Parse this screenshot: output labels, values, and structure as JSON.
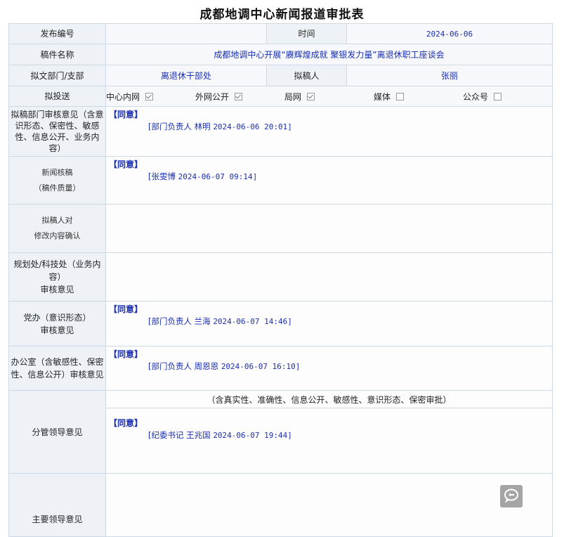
{
  "page_title": "成都地调中心新闻报道审批表",
  "rows": {
    "publish_no": {
      "label": "发布编号",
      "value": ""
    },
    "time": {
      "label": "时间",
      "value": "2024-06-06"
    },
    "manuscript": {
      "label": "稿件名称",
      "value": "成都地调中心开展“赓辉煌成就 聚银发力量”离退休职工座谈会"
    },
    "dept": {
      "label": "拟文部门/支部",
      "value": "离退休干部处"
    },
    "drafter": {
      "label": "拟稿人",
      "value": "张丽"
    },
    "channels": {
      "label": "拟投送",
      "items": [
        {
          "name": "中心内网",
          "checked": true
        },
        {
          "name": "外网公开",
          "checked": true
        },
        {
          "name": "局网",
          "checked": true
        },
        {
          "name": "媒体",
          "checked": false
        },
        {
          "name": "公众号",
          "checked": false
        }
      ]
    },
    "dept_review": {
      "label": "拟稿部门审核意见（含意识形态、保密性、敏感性、信息公开、业务内容）",
      "agree": "【同意】",
      "signer": "[部门负责人 林明",
      "datetime": "2024-06-06 20:01]"
    },
    "news_review": {
      "label_line1": "新闻核稿",
      "label_line2": "（稿件质量）",
      "agree": "【同意】",
      "signer": "[张雯博",
      "datetime": "2024-06-07 09:14]"
    },
    "drafter_confirm": {
      "label_line1": "拟稿人对",
      "label_line2": "修改内容确认"
    },
    "planning_review": {
      "label_line1": "规划处/科技处（业务内容）",
      "label_line2": "审核意见"
    },
    "party_review": {
      "label_line1": "党办（意识形态）",
      "label_line2": "审核意见",
      "agree": "【同意】",
      "signer": "[部门负责人 兰海",
      "datetime": "2024-06-07 14:46]"
    },
    "office_review": {
      "label": "办公室（含敏感性、保密性、信息公开）审核意见",
      "agree": "【同意】",
      "signer": "[部门负责人 周恩恩",
      "datetime": "2024-06-07 16:10]"
    },
    "leader_review": {
      "label": "分管领导意见",
      "note": "（含真实性、准确性、信息公开、敏感性、意识形态、保密审批）",
      "agree": "【同意】",
      "signer": "[纪委书记 王兆国",
      "datetime": "2024-06-07 19:44]"
    },
    "main_leader": {
      "label": "主要领导意见"
    }
  },
  "icons": {
    "chat": "chat-bubble-icon"
  },
  "colors": {
    "label_bg": "#eef1f6",
    "value_text": "#1a2fb0",
    "border": "#cfd9e6"
  }
}
